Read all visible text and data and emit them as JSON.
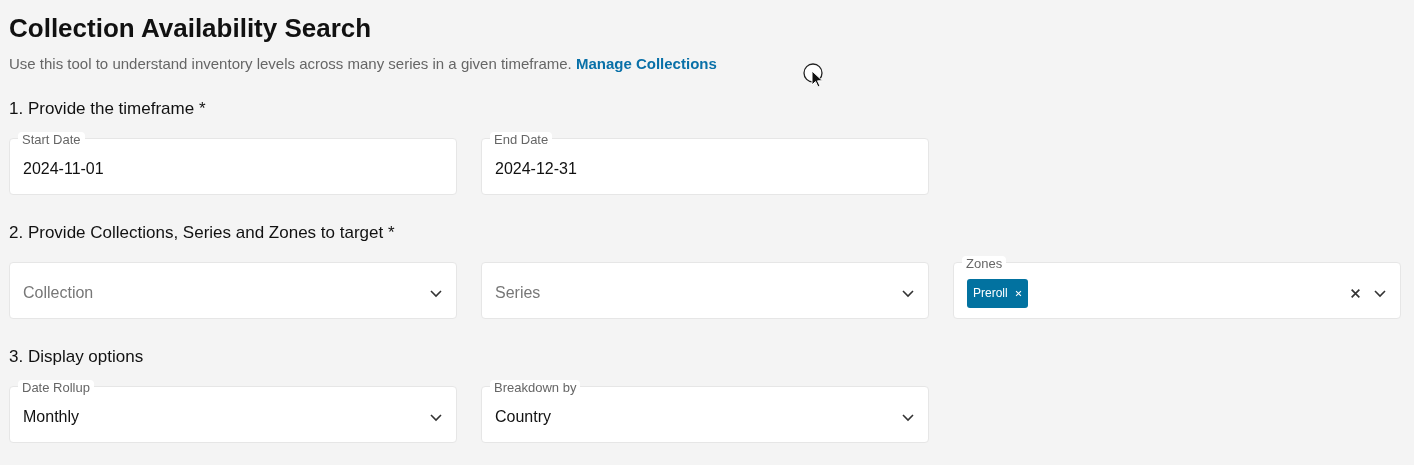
{
  "title": "Collection Availability Search",
  "description": "Use this tool to understand inventory levels across many series in a given timeframe.",
  "link": "Manage Collections",
  "sections": [
    {
      "heading": "1. Provide the timeframe *",
      "fields": [
        {
          "kind": "text",
          "label": "Start Date",
          "value": "2024-11-01"
        },
        {
          "kind": "text",
          "label": "End Date",
          "value": "2024-12-31"
        }
      ]
    },
    {
      "heading": "2. Provide Collections, Series and Zones to target *",
      "fields": [
        {
          "kind": "select",
          "placeholder": "Collection"
        },
        {
          "kind": "select",
          "placeholder": "Series"
        },
        {
          "kind": "multiselect",
          "label": "Zones",
          "chips": [
            "Preroll"
          ]
        }
      ]
    },
    {
      "heading": "3. Display options",
      "fields": [
        {
          "kind": "select",
          "label": "Date Rollup",
          "value": "Monthly"
        },
        {
          "kind": "select",
          "label": "Breakdown by",
          "value": "Country"
        }
      ]
    }
  ]
}
